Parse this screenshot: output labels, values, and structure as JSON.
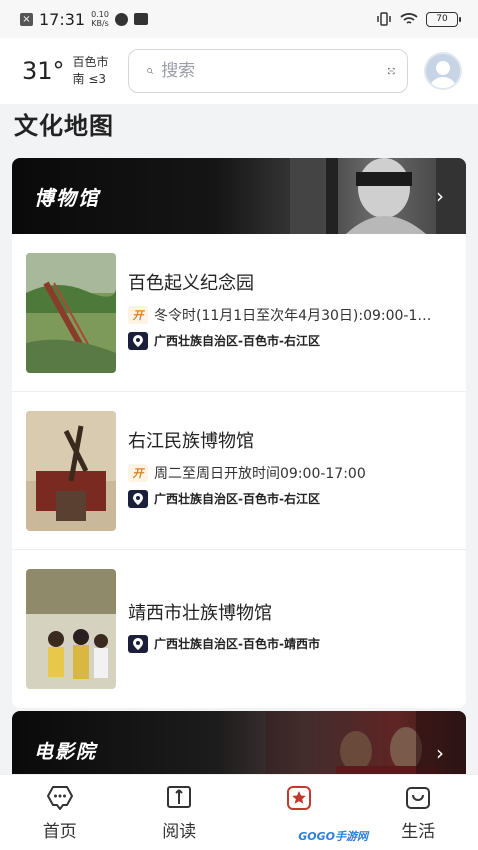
{
  "status_bar": {
    "time": "17:31",
    "net_speed_value": "0.10",
    "net_speed_unit": "KB/s",
    "battery": "70"
  },
  "header": {
    "temperature": "31°",
    "city": "百色市",
    "wind": "南 ≤3",
    "search_placeholder": "搜索"
  },
  "section_title": "文化地图",
  "museum_section": {
    "title": "博物馆",
    "open_icon_label": "开",
    "venues": [
      {
        "name": "百色起义纪念园",
        "hours": "冬令时(11月1日至次年4月30日):09:00-1…",
        "address": "广西壮族自治区-百色市-右江区"
      },
      {
        "name": "右江民族博物馆",
        "hours": "周二至周日开放时间09:00-17:00",
        "address": "广西壮族自治区-百色市-右江区"
      },
      {
        "name": "靖西市壮族博物馆",
        "address": "广西壮族自治区-百色市-靖西市"
      }
    ]
  },
  "cinema_section": {
    "title": "电影院"
  },
  "bottom_nav": [
    {
      "label": "首页",
      "icon": "home-chat-icon"
    },
    {
      "label": "阅读",
      "icon": "book-icon"
    },
    {
      "label": "",
      "icon": "star-badge-icon"
    },
    {
      "label": "生活",
      "icon": "bag-icon"
    }
  ],
  "watermark": "GOGO手游网",
  "colors": {
    "active": "#c0392b",
    "open_icon": "#d9822b",
    "location_icon_bg": "#1c1f3a"
  }
}
